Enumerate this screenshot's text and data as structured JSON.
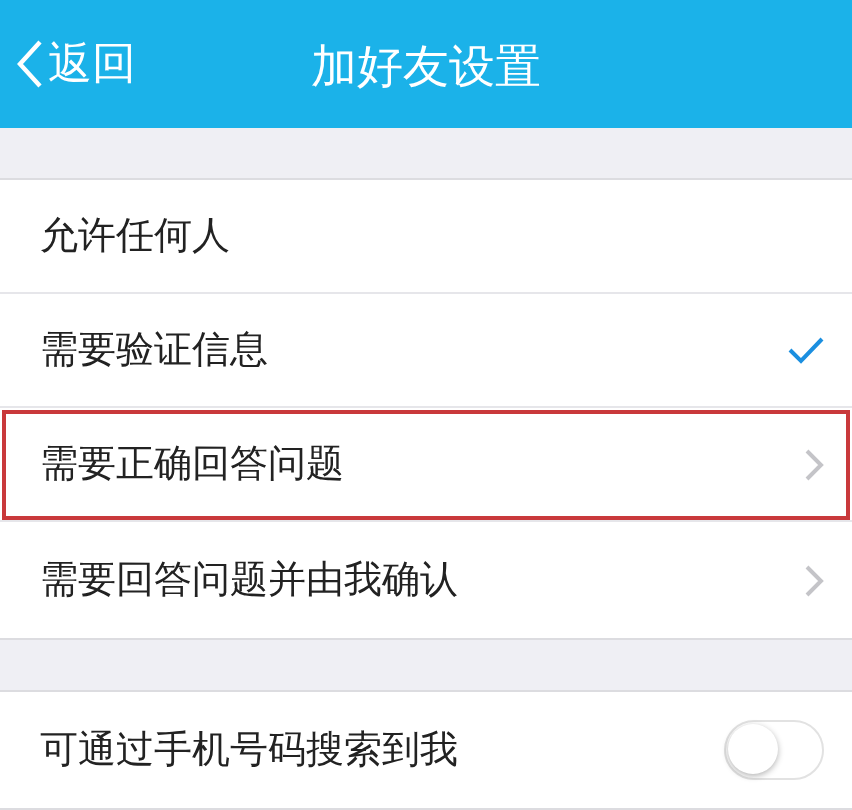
{
  "nav_bar": {
    "back": "返回",
    "title": "加好友设置"
  },
  "groups": [
    {
      "items": [
        {
          "kind": "option",
          "label": "允许任何人",
          "selected": false,
          "highlighted": false
        },
        {
          "kind": "option",
          "label": "需要验证信息",
          "selected": true,
          "highlighted": false
        },
        {
          "kind": "link",
          "label": "需要正确回答问题",
          "highlighted": true
        },
        {
          "kind": "link",
          "label": "需要回答问题并由我确认",
          "highlighted": false
        }
      ]
    },
    {
      "items": [
        {
          "kind": "switch",
          "label": "可通过手机号码搜索到我",
          "on": false,
          "highlighted": false
        }
      ]
    }
  ]
}
